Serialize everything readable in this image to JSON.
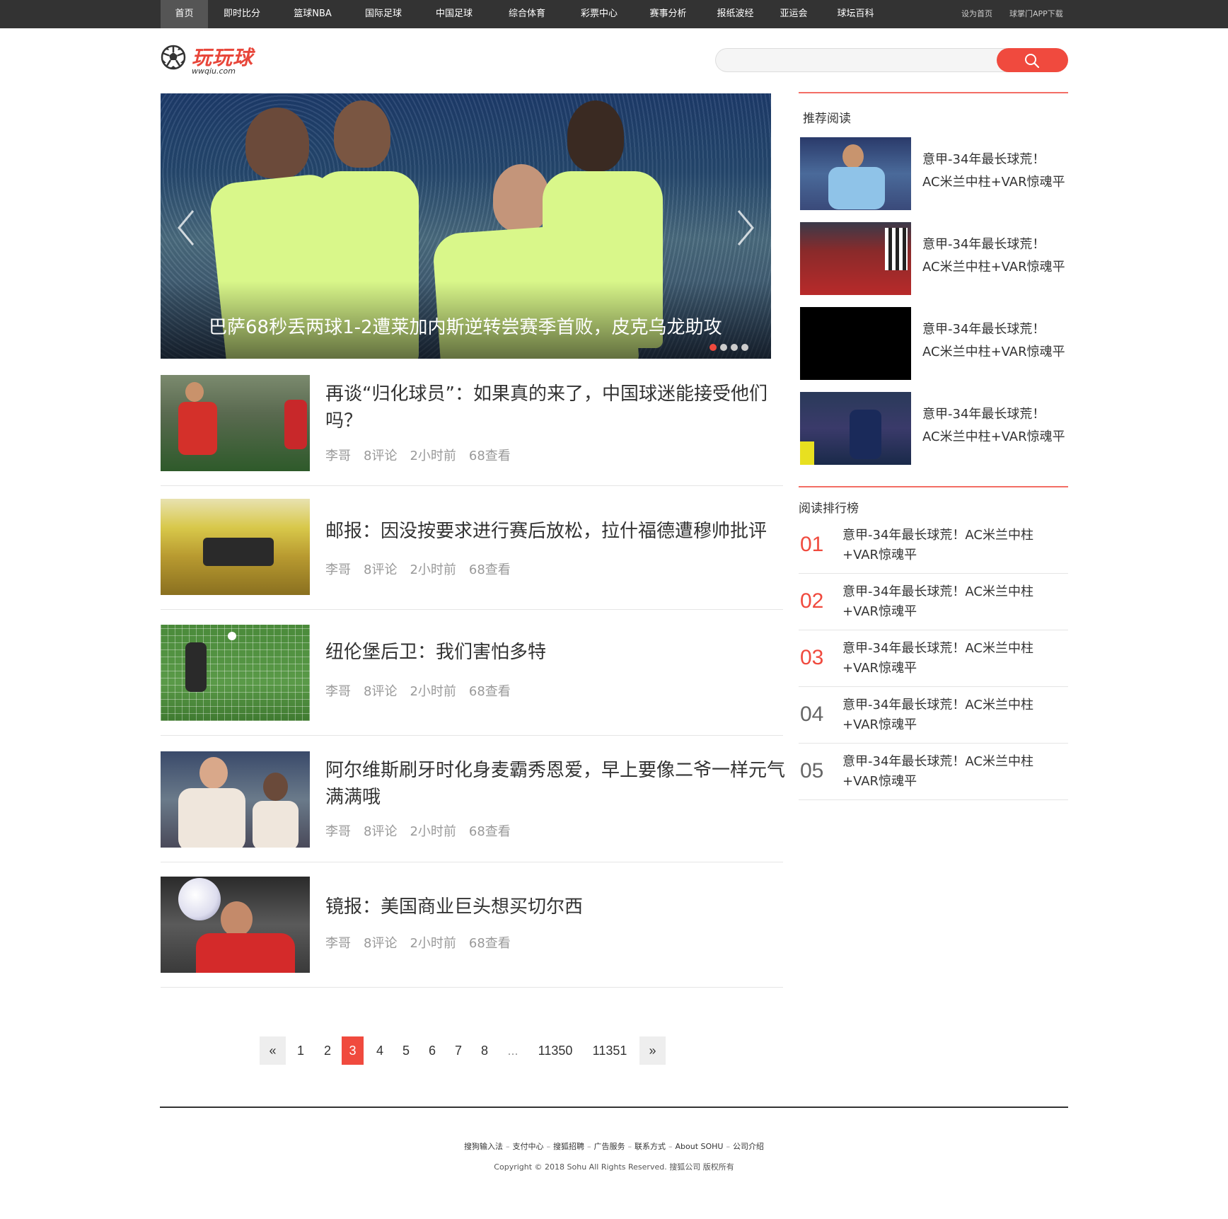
{
  "nav": {
    "items": [
      "首页",
      "即时比分",
      "篮球NBA",
      "国际足球",
      "中国足球",
      "综合体育",
      "彩票中心",
      "赛事分析",
      "报纸波经",
      "亚运会",
      "球坛百科"
    ],
    "right": [
      "设为首页",
      "球掌门APP下载"
    ]
  },
  "logo": {
    "brand": "玩玩球",
    "domain": "wwqiu.com"
  },
  "search": {
    "placeholder": ""
  },
  "slider": {
    "caption": "巴萨68秒丢两球1-2遭莱加内斯逆转尝赛季首败，皮克乌龙助攻",
    "active_dot": 0,
    "dot_count": 4
  },
  "articles": [
    {
      "title": "再谈“归化球员”：如果真的来了，中国球迷能接受他们吗？",
      "author": "李哥",
      "comments": "8评论",
      "time": "2小时前",
      "views": "68查看"
    },
    {
      "title": "邮报：因没按要求进行赛后放松，拉什福德遭穆帅批评",
      "author": "李哥",
      "comments": "8评论",
      "time": "2小时前",
      "views": "68查看"
    },
    {
      "title": "纽伦堡后卫：我们害怕多特",
      "author": "李哥",
      "comments": "8评论",
      "time": "2小时前",
      "views": "68查看"
    },
    {
      "title": "阿尔维斯刷牙时化身麦霸秀恩爱，早上要像二爷一样元气满满哦",
      "author": "李哥",
      "comments": "8评论",
      "time": "2小时前",
      "views": "68查看"
    },
    {
      "title": "镜报：美国商业巨头想买切尔西",
      "author": "李哥",
      "comments": "8评论",
      "time": "2小时前",
      "views": "68查看"
    }
  ],
  "sidebar": {
    "recommend_title": "推荐阅读",
    "recommend": [
      {
        "line1": "意甲-34年最长球荒！",
        "line2": "AC米兰中柱+VAR惊魂平"
      },
      {
        "line1": "意甲-34年最长球荒！",
        "line2": "AC米兰中柱+VAR惊魂平"
      },
      {
        "line1": "意甲-34年最长球荒！",
        "line2": "AC米兰中柱+VAR惊魂平"
      },
      {
        "line1": "意甲-34年最长球荒！",
        "line2": "AC米兰中柱+VAR惊魂平"
      }
    ],
    "rank_title": "阅读排行榜",
    "rank": [
      {
        "num": "01",
        "text": "意甲-34年最长球荒！AC米兰中柱+VAR惊魂平"
      },
      {
        "num": "02",
        "text": "意甲-34年最长球荒！AC米兰中柱+VAR惊魂平"
      },
      {
        "num": "03",
        "text": "意甲-34年最长球荒！AC米兰中柱+VAR惊魂平"
      },
      {
        "num": "04",
        "text": "意甲-34年最长球荒！AC米兰中柱+VAR惊魂平"
      },
      {
        "num": "05",
        "text": "意甲-34年最长球荒！AC米兰中柱+VAR惊魂平"
      }
    ]
  },
  "pager": {
    "prev": "«",
    "next": "»",
    "pages": [
      "1",
      "2",
      "3",
      "4",
      "5",
      "6",
      "7",
      "8",
      "...",
      "11350",
      "11351"
    ],
    "current": "3"
  },
  "footer": {
    "links": [
      "搜狗输入法",
      "支付中心",
      "搜狐招聘",
      "广告服务",
      "联系方式",
      "About SOHU",
      "公司介绍"
    ],
    "copyright": "Copyright © 2018 Sohu All Rights Reserved. 搜狐公司 版权所有"
  },
  "colors": {
    "accent": "#f04a3e",
    "nav_bg": "#333333"
  }
}
